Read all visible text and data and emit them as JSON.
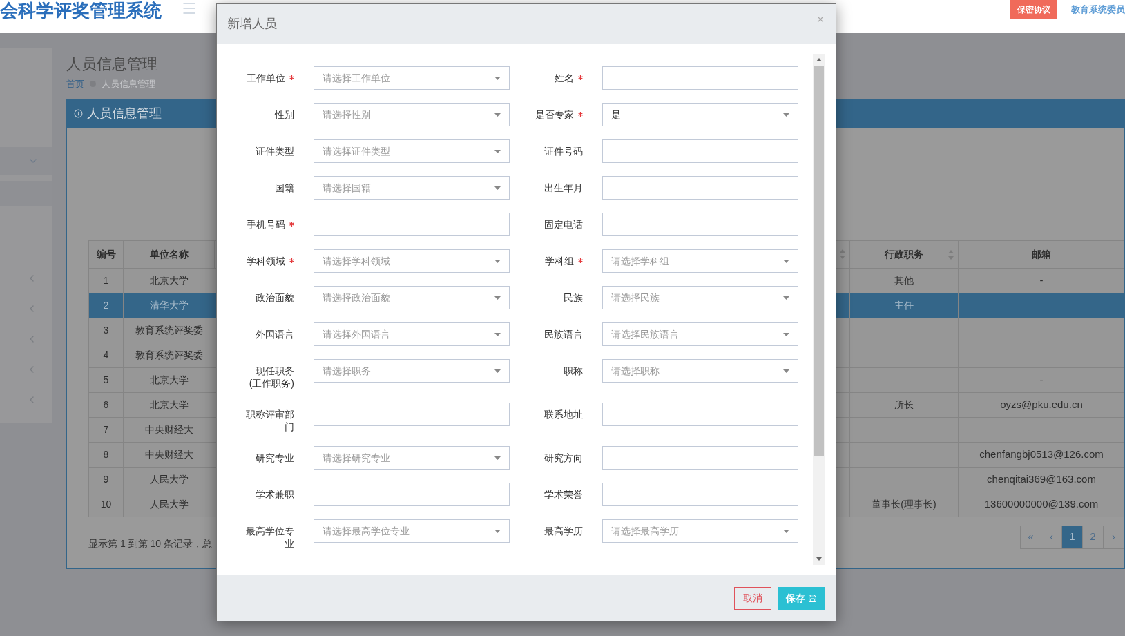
{
  "header": {
    "title": "会科学评奖管理系统",
    "badge": "保密协议",
    "user": "教育系统委员"
  },
  "page": {
    "title": "人员信息管理",
    "breadcrumb": [
      "首页",
      "人员信息管理"
    ]
  },
  "panel": {
    "title": "人员信息管理"
  },
  "table": {
    "columns": [
      {
        "label": "编号",
        "sortable": false
      },
      {
        "label": "单位名称",
        "sortable": false
      },
      {
        "sortable": true
      },
      {
        "label": "行政职务",
        "sortable": true
      },
      {
        "label": "邮箱",
        "sortable": false
      }
    ],
    "rows": [
      {
        "number": "1",
        "unit": "北京大学",
        "admin_post": "其他",
        "email": "-",
        "selected": false
      },
      {
        "number": "2",
        "unit": "清华大学",
        "admin_post": "主任",
        "selected": true
      },
      {
        "number": "3",
        "unit": "教育系统评奖委",
        "selected": false
      },
      {
        "number": "4",
        "unit": "教育系统评奖委",
        "selected": false
      },
      {
        "number": "5",
        "unit": "北京大学",
        "email": "-",
        "selected": false
      },
      {
        "number": "6",
        "unit": "北京大学",
        "admin_post": "所长",
        "email": "oyzs@pku.edu.cn",
        "selected": false
      },
      {
        "number": "7",
        "unit": "中央财经大",
        "selected": false
      },
      {
        "number": "8",
        "unit": "中央财经大",
        "email": "chenfangbj0513@126.com",
        "selected": false
      },
      {
        "number": "9",
        "unit": "人民大学",
        "email": "chenqitai369@163.com",
        "selected": false
      },
      {
        "number": "10",
        "unit": "人民大学",
        "admin_post": "董事长(理事长)",
        "email": "13600000000@139.com",
        "selected": false
      }
    ]
  },
  "table_footer": "显示第 1 到第 10 条记录，总",
  "pagination": [
    {
      "label": "«",
      "selected": false
    },
    {
      "label": "‹",
      "selected": false
    },
    {
      "label": "1",
      "selected": true
    },
    {
      "label": "2",
      "selected": false
    },
    {
      "label": "›",
      "selected": false
    }
  ],
  "modal": {
    "title": "新增人员",
    "fields": [
      {
        "label": "工作单位",
        "required": true,
        "kind": "select",
        "placeholder": "请选择工作单位"
      },
      {
        "label": "姓名",
        "required": true,
        "kind": "text"
      },
      {
        "label": "性别",
        "required": false,
        "kind": "select",
        "placeholder": "请选择性别"
      },
      {
        "label": "是否专家",
        "required": true,
        "kind": "select",
        "value": "是"
      },
      {
        "label": "证件类型",
        "required": false,
        "kind": "select",
        "placeholder": "请选择证件类型"
      },
      {
        "label": "证件号码",
        "required": false,
        "kind": "text"
      },
      {
        "label": "国籍",
        "required": false,
        "kind": "select",
        "placeholder": "请选择国籍"
      },
      {
        "label": "出生年月",
        "required": false,
        "kind": "text"
      },
      {
        "label": "手机号码",
        "required": true,
        "kind": "text"
      },
      {
        "label": "固定电话",
        "required": false,
        "kind": "text"
      },
      {
        "label": "学科领域",
        "required": true,
        "kind": "select",
        "placeholder": "请选择学科领域"
      },
      {
        "label": "学科组",
        "required": true,
        "kind": "select",
        "placeholder": "请选择学科组"
      },
      {
        "label": "政治面貌",
        "required": false,
        "kind": "select",
        "placeholder": "请选择政治面貌"
      },
      {
        "label": "民族",
        "required": false,
        "kind": "select",
        "placeholder": "请选择民族"
      },
      {
        "label": "外国语言",
        "required": false,
        "kind": "select",
        "placeholder": "请选择外国语言"
      },
      {
        "label": "民族语言",
        "required": false,
        "kind": "select",
        "placeholder": "请选择民族语言"
      },
      {
        "label": "现任职务(工作职务)",
        "required": false,
        "kind": "select",
        "placeholder": "请选择职务"
      },
      {
        "label": "职称",
        "required": false,
        "kind": "select",
        "placeholder": "请选择职称"
      },
      {
        "label": "职称评审部门",
        "required": false,
        "kind": "text"
      },
      {
        "label": "联系地址",
        "required": false,
        "kind": "text"
      },
      {
        "label": "研究专业",
        "required": false,
        "kind": "select",
        "placeholder": "请选择研究专业"
      },
      {
        "label": "研究方向",
        "required": false,
        "kind": "text"
      },
      {
        "label": "学术兼职",
        "required": false,
        "kind": "text"
      },
      {
        "label": "学术荣誉",
        "required": false,
        "kind": "text"
      },
      {
        "label": "最高学位专业",
        "required": false,
        "kind": "select",
        "placeholder": "请选择最高学位专业"
      },
      {
        "label": "最高学历",
        "required": false,
        "kind": "select",
        "placeholder": "请选择最高学历"
      }
    ],
    "buttons": [
      {
        "kind": "cancel",
        "label": "取消"
      },
      {
        "kind": "save",
        "label": "保存"
      }
    ]
  }
}
